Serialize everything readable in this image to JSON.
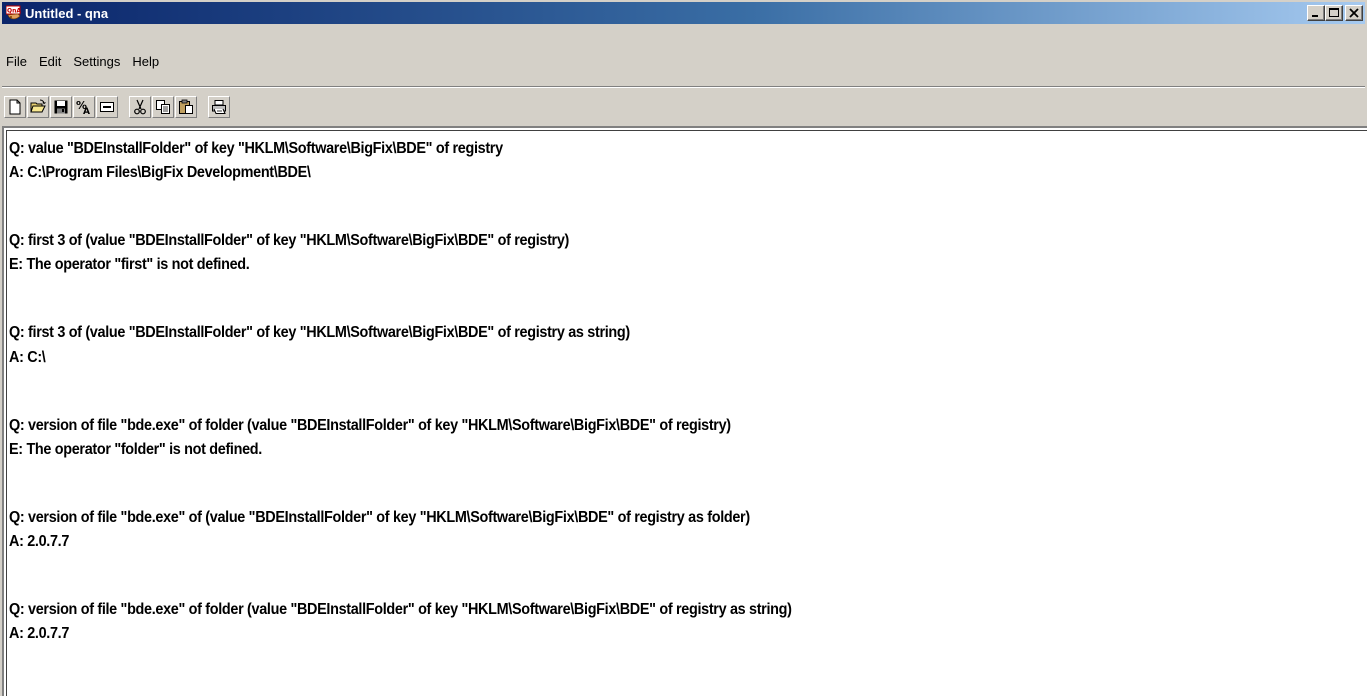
{
  "window": {
    "title": "Untitled - qna",
    "icon": "qna-app-icon",
    "buttons": {
      "minimize": "_",
      "maximize": "□",
      "close": "×"
    }
  },
  "menu": {
    "items": [
      "File",
      "Edit",
      "Settings",
      "Help"
    ]
  },
  "toolbar": {
    "buttons": [
      {
        "icon": "new-document-icon"
      },
      {
        "icon": "open-folder-icon"
      },
      {
        "icon": "save-disk-icon"
      },
      {
        "icon": "percent-a-icon"
      },
      {
        "icon": "window-icon"
      },
      {
        "icon": "cut-scissors-icon"
      },
      {
        "icon": "copy-icon"
      },
      {
        "icon": "paste-icon"
      },
      {
        "icon": "print-icon"
      }
    ]
  },
  "editor": {
    "lines": [
      "Q: value \"BDEInstallFolder\" of key \"HKLM\\Software\\BigFix\\BDE\" of registry",
      "A: C:\\Program Files\\BigFix Development\\BDE\\",
      "",
      "Q: first 3 of (value \"BDEInstallFolder\" of key \"HKLM\\Software\\BigFix\\BDE\" of registry)",
      "E: The operator \"first\" is not defined.",
      "",
      "Q: first 3 of (value \"BDEInstallFolder\" of key \"HKLM\\Software\\BigFix\\BDE\" of registry as string)",
      "A: C:\\",
      "",
      "Q: version of file \"bde.exe\" of folder (value \"BDEInstallFolder\" of key \"HKLM\\Software\\BigFix\\BDE\" of registry)",
      "E: The operator \"folder\" is not defined.",
      "",
      "Q: version of file \"bde.exe\" of (value \"BDEInstallFolder\" of key \"HKLM\\Software\\BigFix\\BDE\" of registry as folder)",
      "A: 2.0.7.7",
      "",
      "Q: version of file \"bde.exe\" of folder (value \"BDEInstallFolder\" of key \"HKLM\\Software\\BigFix\\BDE\" of registry as string)",
      "A: 2.0.7.7"
    ]
  }
}
